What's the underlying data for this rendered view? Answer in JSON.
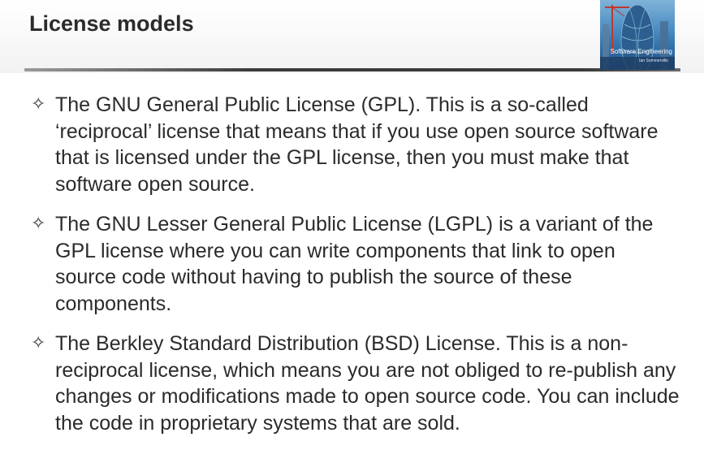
{
  "slide": {
    "title": "License models"
  },
  "thumbnail": {
    "title": "Software Engineering",
    "author": "Ian Sommerville"
  },
  "bullet_glyph": "✧",
  "bullets": [
    {
      "text": "The GNU General Public License (GPL). This is a so-called ‘reciprocal’ license that means that if you use open source software that is licensed under the GPL license, then you must make that software open source."
    },
    {
      "text": "The GNU Lesser General Public License (LGPL) is a variant of the GPL license where you can write components that link to open source code without having to publish the source of these components."
    },
    {
      "text": "The Berkley Standard Distribution (BSD) License. This is a non-reciprocal license, which means you are not obliged to re-publish any changes or modifications made to open source code. You can include the code in proprietary systems that are sold."
    }
  ]
}
